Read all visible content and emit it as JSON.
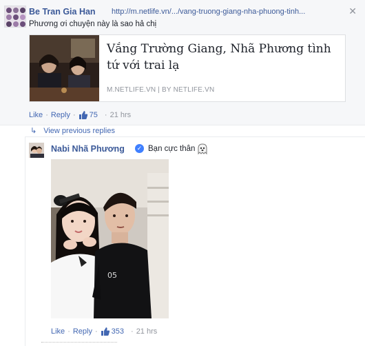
{
  "comment1": {
    "author": "Be Tran Gia Han",
    "link": "http://m.netlife.vn/.../vang-truong-giang-nha-phuong-tinh...",
    "text": "Phương ơi chuyện này là sao hả chị",
    "preview": {
      "title": "Vắng Trường Giang, Nhã Phương tình tứ với trai lạ",
      "source": "M.NETLIFE.VN | BY NETLIFE.VN"
    },
    "actions": {
      "like": "Like",
      "sep": "·",
      "reply": "Reply",
      "likes": "75",
      "time": "21 hrs"
    }
  },
  "view_previous": "View previous replies",
  "comment2": {
    "author": "Nabi Nhã Phương",
    "verified": "✓",
    "text": "Bạn cực thân",
    "actions": {
      "like": "Like",
      "sep": "·",
      "reply": "Reply",
      "likes": "353",
      "time": "21 hrs"
    }
  },
  "icons": {
    "close": "close-icon",
    "like": "thumbs-up-icon",
    "reply_arrow": "reply-arrow-icon",
    "verified": "verified-badge-icon",
    "emoji": "ghost-emoji-icon"
  },
  "colors": {
    "link_blue": "#3b5998",
    "action_blue": "#4267b2",
    "meta_gray": "#90949c",
    "verified_blue": "#4080ff"
  }
}
